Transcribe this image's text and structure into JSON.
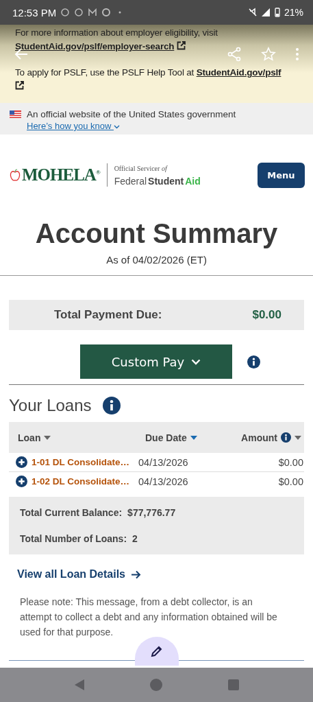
{
  "status_bar": {
    "time": "12:53 PM",
    "battery": "21%"
  },
  "notice": {
    "line1": "For more information about employer eligibility, visit",
    "link1": "StudentAid.gov/pslf/employer-search",
    "line2": "To apply for PSLF, use the PSLF Help Tool at",
    "link2": "StudentAid.gov/pslf"
  },
  "gov_banner": {
    "text": "An official website of the United States government",
    "link": "Here’s how you know"
  },
  "header": {
    "logo": "MOHELA",
    "registered": "®",
    "servicer": "Official Servicer",
    "servicer_of": "of",
    "fsa_federal": "Federal",
    "fsa_student": "Student",
    "fsa_aid": "Aid",
    "menu": "Menu"
  },
  "title": "Account Summary",
  "as_of": "As of 04/02/2026 (ET)",
  "payment_due": {
    "label": "Total Payment Due:",
    "value": "$0.00"
  },
  "custom_pay": "Custom Pay",
  "loans": {
    "heading": "Your Loans",
    "columns": [
      {
        "label": "Loan",
        "sorted": false,
        "info": false
      },
      {
        "label": "Due Date",
        "sorted": true,
        "info": false
      },
      {
        "label": "Amount",
        "sorted": false,
        "info": true
      }
    ],
    "rows": [
      {
        "loan": "1-01 DL Consolidate…",
        "due": "04/13/2026",
        "amount": "$0.00"
      },
      {
        "loan": "1-02 DL Consolidate…",
        "due": "04/13/2026",
        "amount": "$0.00"
      }
    ],
    "totals": [
      {
        "label": "Total Current Balance:",
        "value": "$77,776.77"
      },
      {
        "label": "Total Number of Loans:",
        "value": "2"
      }
    ],
    "details_link": "View all Loan Details"
  },
  "note": "Please note: This message, from a debt collector, is an attempt to collect a debt and any information obtained will be used for that purpose."
}
